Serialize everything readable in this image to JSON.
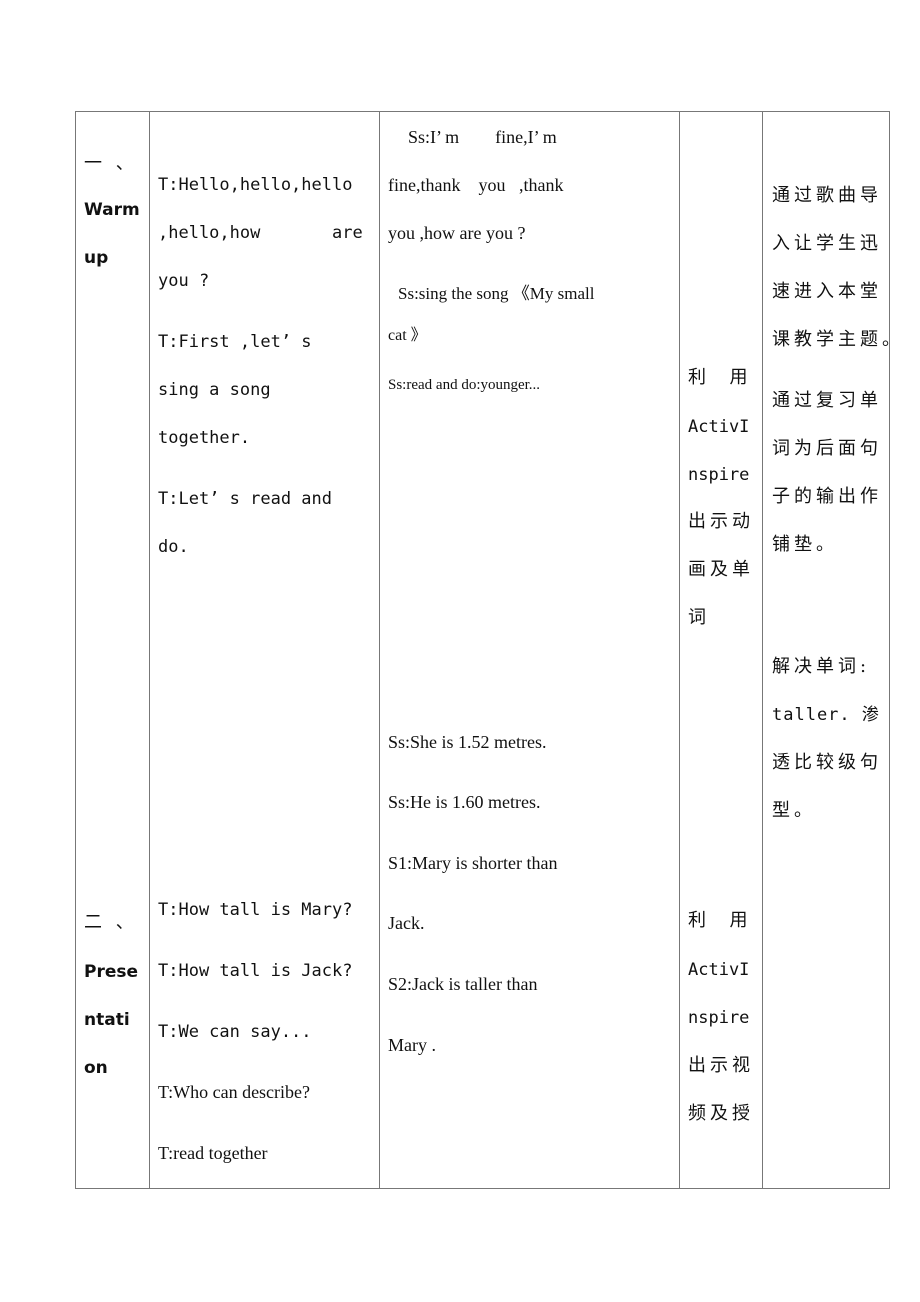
{
  "table": {
    "rows": [
      {
        "step": {
          "number": "一 、",
          "title_lines": [
            "Warm",
            "up"
          ]
        },
        "teacher": [
          "T:Hello,hello,hello",
          ",hello,how       are",
          "you ?",
          "T:First ,let’ s",
          "sing a song",
          "together.",
          "T:Let’ s read and",
          "do."
        ],
        "students": [
          "Ss:I’ m        fine,I’ m",
          "fine,thank    you   ,thank",
          "you ,how are you ?",
          "Ss:sing the song 《My small",
          "cat 》",
          "Ss:read and do:younger...",
          "Ss:She is 1.52 metres.",
          "Ss:He is 1.60 metres.",
          "S1:Mary is shorter than",
          "Jack.",
          "S2:Jack is taller than",
          "Mary ."
        ],
        "media": [
          "利  用",
          "ActivI",
          "nspire",
          "出示动",
          "画及单",
          "词"
        ],
        "purpose": [
          "通过歌曲导",
          "入让学生迅",
          "速进入本堂",
          "课教学主题。",
          "通过复习单",
          "词为后面句",
          "子的输出作",
          "铺垫。",
          "解决单词:",
          "taller. 渗",
          "透比较级句",
          "型。"
        ]
      },
      {
        "step": {
          "number": "二 、",
          "title_lines": [
            "Prese",
            "ntati",
            "on"
          ]
        },
        "teacher": [
          "T:How tall is Mary?",
          "T:How tall is Jack?",
          "T:We can say...",
          "T:Who can describe?",
          "T:read together"
        ],
        "media": [
          "利  用",
          "ActivI",
          "nspire",
          "出示视",
          "频及授"
        ]
      }
    ]
  }
}
